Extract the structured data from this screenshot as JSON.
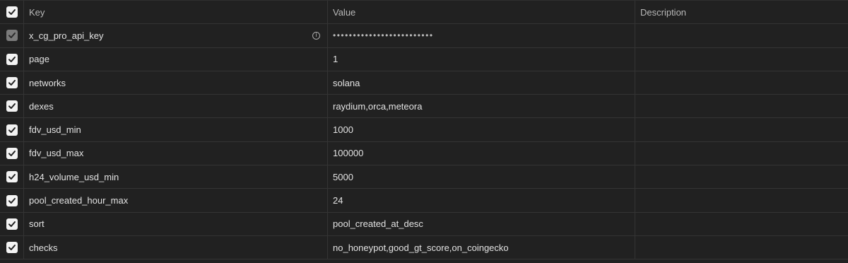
{
  "columns": {
    "key": "Key",
    "value": "Value",
    "description": "Description"
  },
  "rows": [
    {
      "key": "x_cg_pro_api_key",
      "value": "•••••••••••••••••••••••••",
      "description": "",
      "checked": true,
      "disabled": true,
      "info": true
    },
    {
      "key": "page",
      "value": "1",
      "description": "",
      "checked": true
    },
    {
      "key": "networks",
      "value": "solana",
      "description": "",
      "checked": true
    },
    {
      "key": "dexes",
      "value": "raydium,orca,meteora",
      "description": "",
      "checked": true
    },
    {
      "key": "fdv_usd_min",
      "value": "1000",
      "description": "",
      "checked": true
    },
    {
      "key": "fdv_usd_max",
      "value": "100000",
      "description": "",
      "checked": true
    },
    {
      "key": "h24_volume_usd_min",
      "value": "5000",
      "description": "",
      "checked": true
    },
    {
      "key": "pool_created_hour_max",
      "value": "24",
      "description": "",
      "checked": true
    },
    {
      "key": "sort",
      "value": "pool_created_at_desc",
      "description": "",
      "checked": true
    },
    {
      "key": "checks",
      "value": "no_honeypot,good_gt_score,on_coingecko",
      "description": "",
      "checked": true
    }
  ],
  "icons": {
    "checkbox": "checkmark-icon",
    "info": "info-icon"
  },
  "colors": {
    "background": "#212121",
    "border": "#343434",
    "checkbox": "#f3f3f3",
    "checkbox_disabled": "#7b7b7b"
  }
}
